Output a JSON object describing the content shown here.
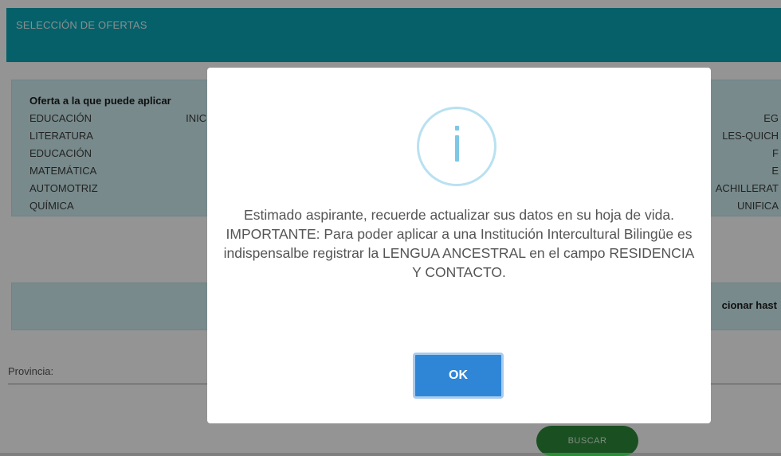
{
  "header": {
    "title": "SELECCIÓN DE OFERTAS"
  },
  "offers": {
    "heading": "Oferta a la que puede aplicar",
    "lines": [
      "EDUCACIÓN INICIAL - EDUCA                                                                            TICA 2º EG",
      "LITERATURA BACHILLERATO                                                                               LES-QUICH",
      "EDUCACIÓN GENERAL BÁSI                                                                             (BGU) - F",
      "MATEMÁTICA EDUCACIÓN G                                                                            GENERAL E",
      "AUTOMOTRIZ - EDUCACIÓN                                                                            ACHILLERAT",
      "QUÍMICA BACHILLERATO GEN                                                                          AL UNIFICA"
    ]
  },
  "info_banner": {
    "text": "cionar hast"
  },
  "filters": {
    "provincia_label": "Provincia:"
  },
  "actions": {
    "buscar_label": "BUSCAR"
  },
  "modal": {
    "message": "Estimado aspirante, recuerde actualizar sus datos en su hoja de vida. IMPORTANTE: Para poder aplicar a una Institución Intercultural Bilingüe es indispensalbe registrar la LENGUA ANCESTRAL en el campo RESIDENCIA Y CONTACTO.",
    "ok_label": "OK",
    "icon": "info-icon"
  },
  "colors": {
    "header": "#0aa5b5",
    "info_box": "#cfeef2",
    "ok_button": "#2f86d6",
    "buscar_button": "#2e8b3a",
    "info_icon": "#7dc8e6"
  }
}
